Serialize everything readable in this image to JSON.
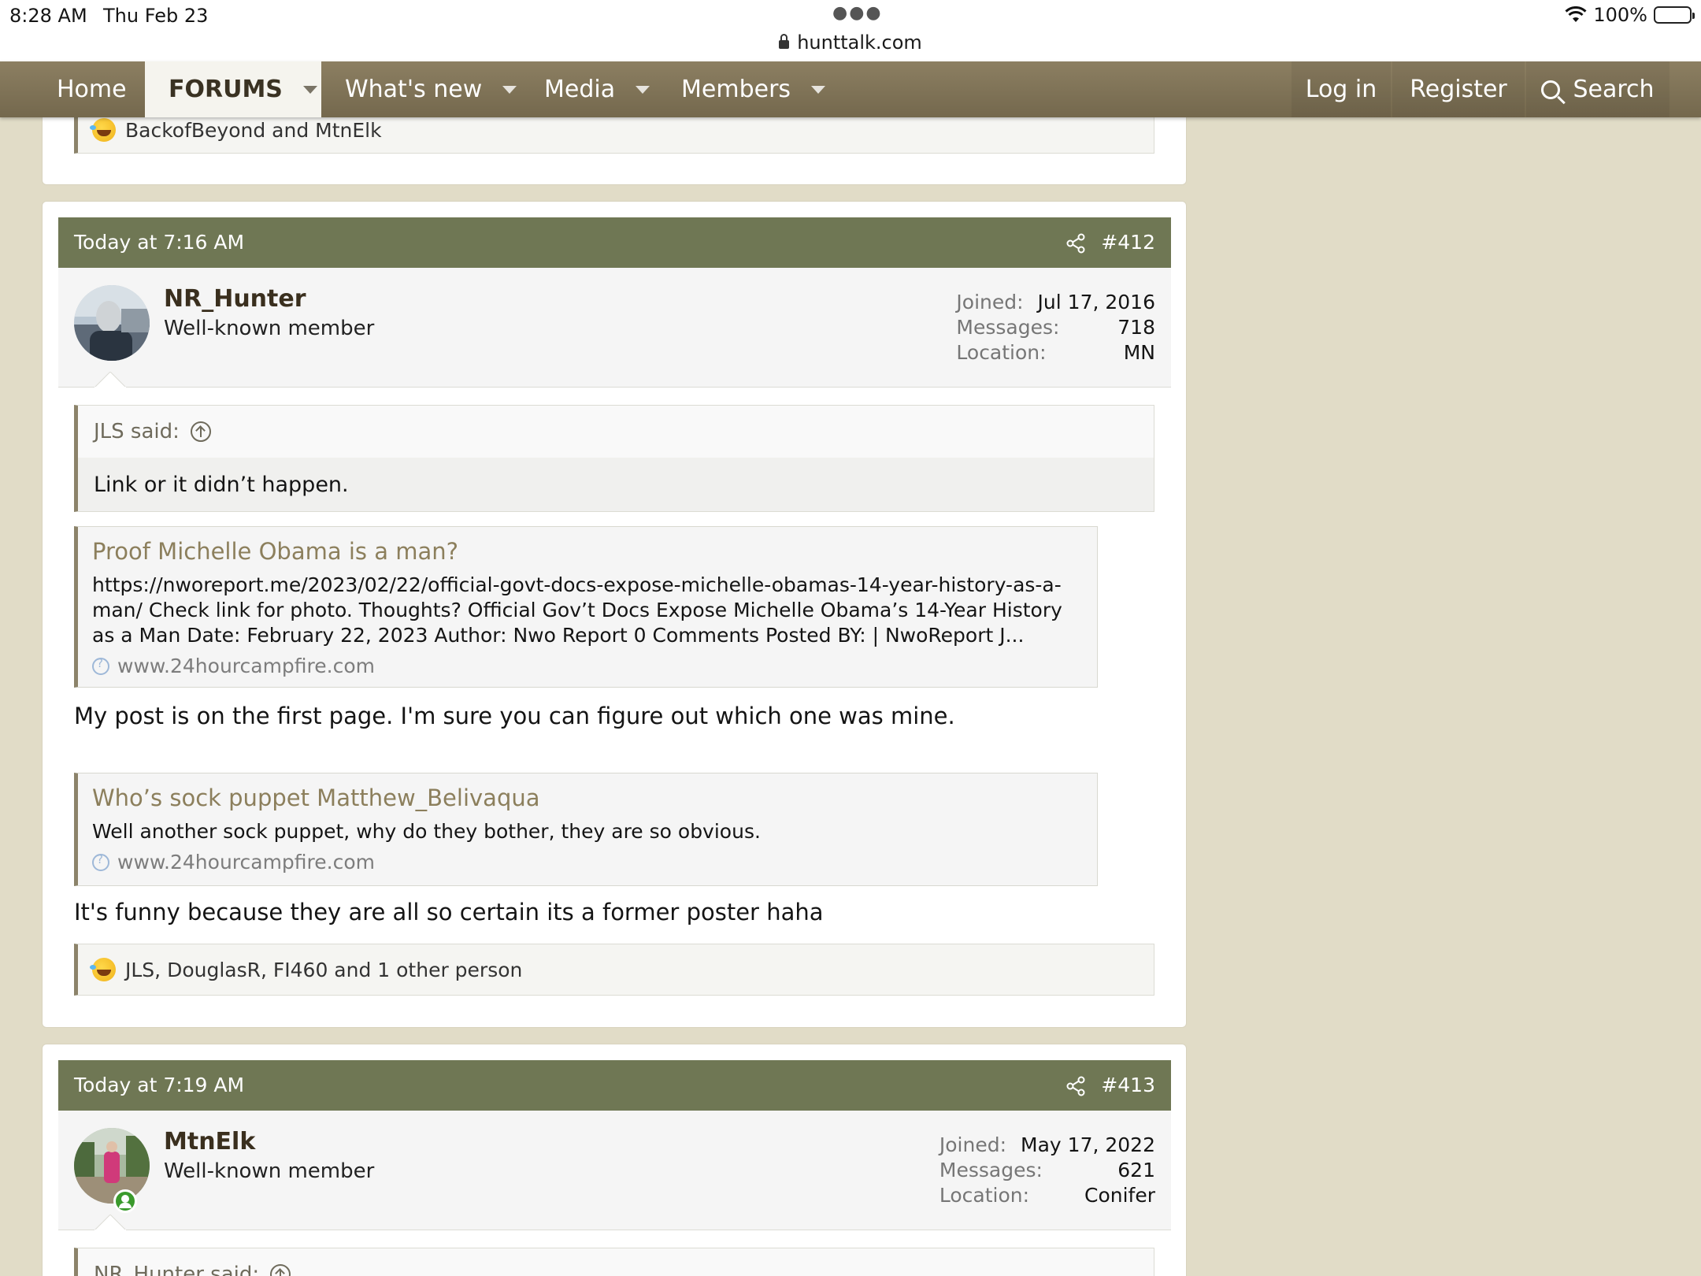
{
  "status_bar": {
    "time": "8:28 AM",
    "date": "Thu Feb 23",
    "url": "hunttalk.com",
    "battery": "100%"
  },
  "nav": {
    "items": [
      {
        "label": "Home"
      },
      {
        "label": "FORUMS"
      },
      {
        "label": "What's new"
      },
      {
        "label": "Media"
      },
      {
        "label": "Members"
      }
    ],
    "login": "Log in",
    "register": "Register",
    "search": "Search"
  },
  "prev_post": {
    "reactions": "BackofBeyond and MtnElk"
  },
  "post412": {
    "date": "Today at 7:16 AM",
    "number": "#412",
    "username": "NR_Hunter",
    "user_title": "Well-known member",
    "stats": [
      {
        "label": "Joined:",
        "value": "Jul 17, 2016"
      },
      {
        "label": "Messages:",
        "value": "718"
      },
      {
        "label": "Location:",
        "value": "MN"
      }
    ],
    "quote": {
      "author": "JLS said:",
      "text": "Link or it didn’t happen."
    },
    "link1": {
      "title": "Proof Michelle Obama is a man?",
      "text": "https://nworeport.me/2023/02/22/official-govt-docs-expose-michelle-obamas-14-year-history-as-a-man/ Check link for photo. Thoughts? Official Gov’t Docs Expose Michelle Obama’s 14-Year History as a Man Date: February 22, 2023 Author: Nwo Report 0 Comments Posted BY: | NwoReport J...",
      "domain": "www.24hourcampfire.com"
    },
    "text1": "My post is on the first page. I'm sure you can figure out which one was mine.",
    "link2": {
      "title": "Who’s sock puppet Matthew_Belivaqua",
      "text": "Well another sock puppet, why do they bother, they are so obvious.",
      "domain": "www.24hourcampfire.com"
    },
    "text2": "It's funny because they are all so certain its a former poster haha",
    "reactions": "JLS, DouglasR, FI460 and 1 other person"
  },
  "post413": {
    "date": "Today at 7:19 AM",
    "number": "#413",
    "username": "MtnElk",
    "user_title": "Well-known member",
    "stats": [
      {
        "label": "Joined:",
        "value": "May 17, 2022"
      },
      {
        "label": "Messages:",
        "value": "621"
      },
      {
        "label": "Location:",
        "value": "Conifer"
      }
    ],
    "quote_author": "NR_Hunter said:"
  },
  "colors": {
    "nav_bg": "#7e7257",
    "post_header": "#6f7754",
    "page_bg": "#e1dcc7",
    "link_title": "#8c7f5c"
  }
}
